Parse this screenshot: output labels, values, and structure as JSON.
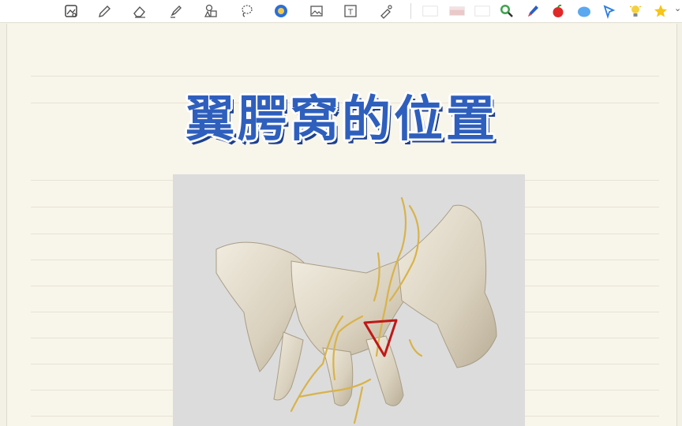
{
  "toolbar": {
    "tools": [
      {
        "name": "view-mode-icon"
      },
      {
        "name": "pen-icon"
      },
      {
        "name": "eraser-icon"
      },
      {
        "name": "highlighter-icon"
      },
      {
        "name": "shapes-icon"
      },
      {
        "name": "lasso-icon"
      },
      {
        "name": "sticker-icon"
      },
      {
        "name": "image-icon"
      },
      {
        "name": "text-box-icon"
      },
      {
        "name": "laser-pointer-icon"
      }
    ],
    "text_icon_glyph": "T",
    "swatches": [
      "#ffffff",
      "#e9c9c9",
      "#ffffff"
    ]
  },
  "page": {
    "title": "翼腭窝的位置"
  },
  "colors": {
    "title_fill": "#2f5fbd",
    "title_shadow": "#1c3f8f",
    "paper": "#f8f5ea",
    "annotation_red": "#c01818",
    "nerve": "#d8b34a"
  }
}
